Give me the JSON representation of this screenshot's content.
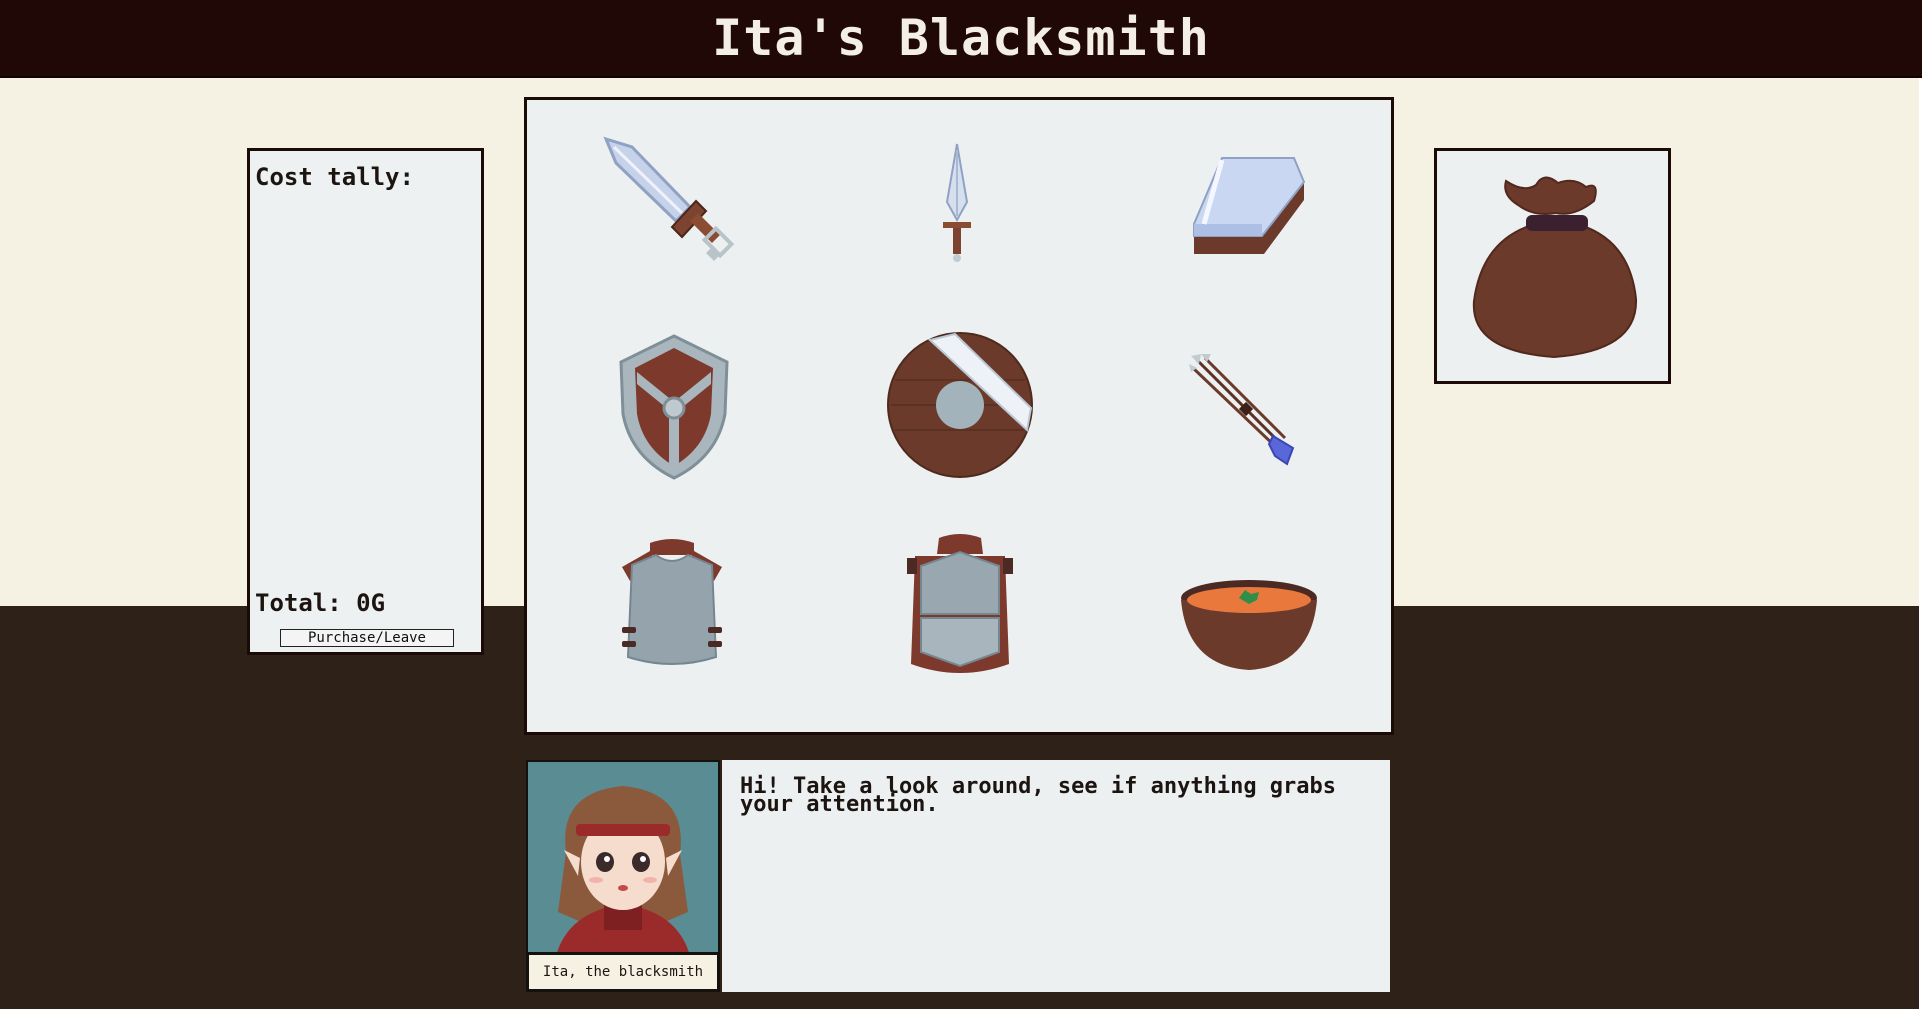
{
  "header": {
    "title": "Ita's Blacksmith"
  },
  "tally": {
    "heading": "Cost tally:",
    "total": "Total: 0G",
    "purchase_label": "Purchase/Leave"
  },
  "shop": {
    "items": [
      {
        "name": "sword"
      },
      {
        "name": "dagger"
      },
      {
        "name": "whetstone"
      },
      {
        "name": "kite-shield"
      },
      {
        "name": "round-shield"
      },
      {
        "name": "arrows"
      },
      {
        "name": "plate-vest"
      },
      {
        "name": "chest-armor"
      },
      {
        "name": "soup-bowl"
      }
    ]
  },
  "dialog": {
    "speaker": "Ita, the blacksmith",
    "message": "Hi! Take a look around, see if anything grabs your attention."
  },
  "colors": {
    "header_bg": "#200806",
    "upper_bg": "#f5f2e3",
    "lower_bg": "#2d2118",
    "panel_bg": "#ecf0f0",
    "wood": "#6b3a2a",
    "steel": "#93a3ab"
  }
}
